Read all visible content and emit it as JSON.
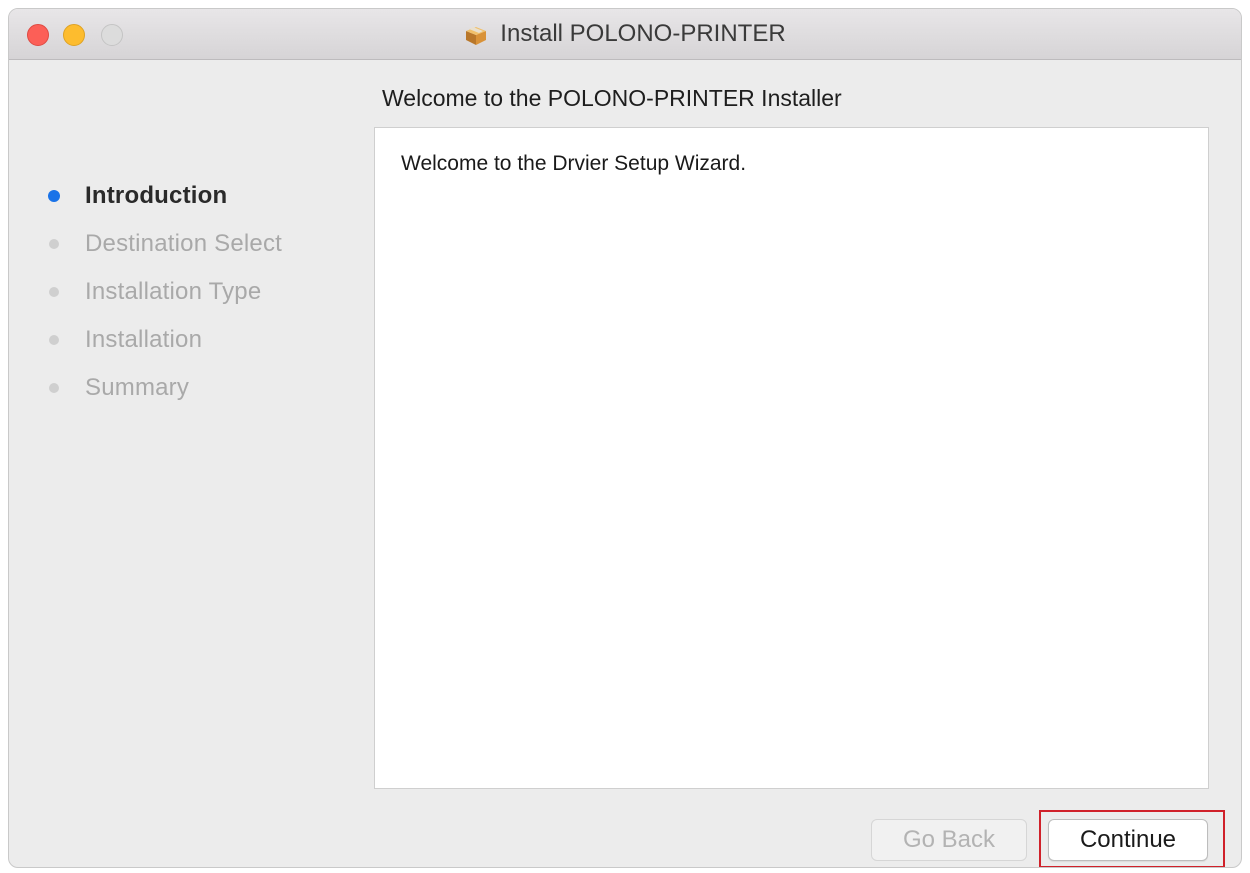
{
  "window": {
    "title": "Install POLONO-PRINTER",
    "title_icon": "package-icon"
  },
  "colors": {
    "accent": "#1a73e8",
    "close": "#fc5f57",
    "minimize": "#fdbc2e",
    "zoom_disabled": "#dcdcdc",
    "highlight": "#d0212a"
  },
  "main": {
    "heading": "Welcome to the POLONO-PRINTER Installer",
    "content_text": "Welcome to the Drvier Setup Wizard."
  },
  "sidebar": {
    "steps": [
      {
        "label": "Introduction",
        "active": true
      },
      {
        "label": "Destination Select",
        "active": false
      },
      {
        "label": "Installation Type",
        "active": false
      },
      {
        "label": "Installation",
        "active": false
      },
      {
        "label": "Summary",
        "active": false
      }
    ]
  },
  "footer": {
    "go_back_label": "Go Back",
    "continue_label": "Continue"
  }
}
